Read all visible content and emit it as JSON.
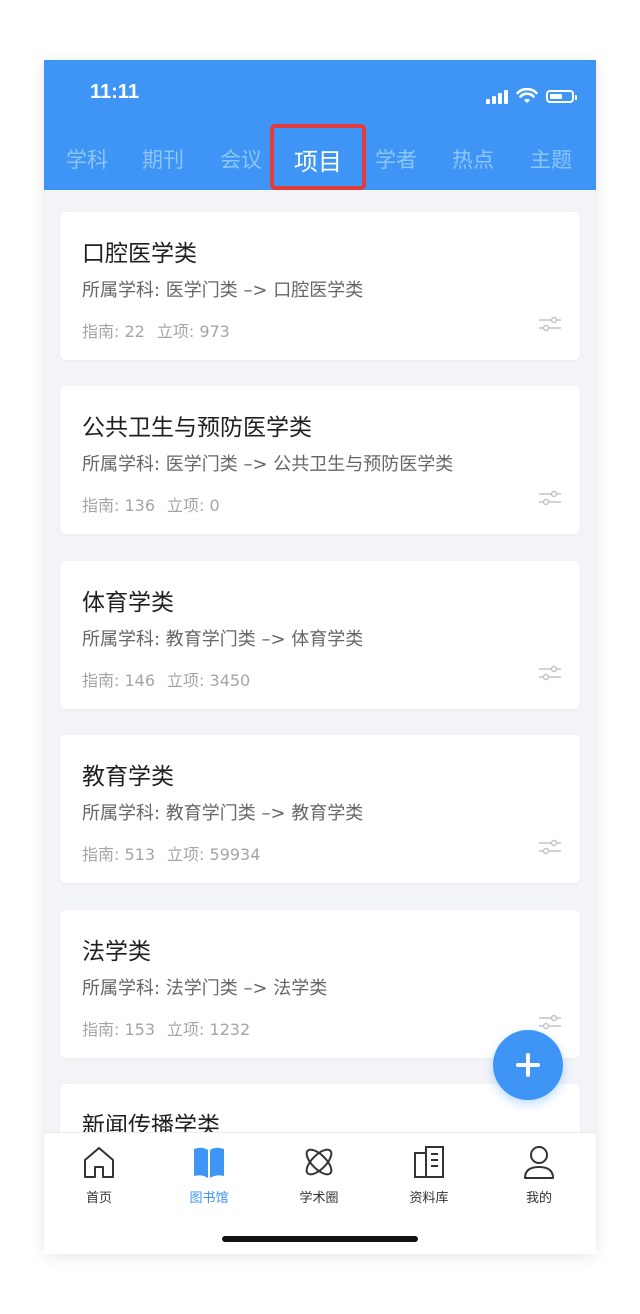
{
  "status_bar": {
    "time": "11:11"
  },
  "tabs": [
    {
      "label": "学科",
      "active": false
    },
    {
      "label": "期刊",
      "active": false
    },
    {
      "label": "会议",
      "active": false
    },
    {
      "label": "项目",
      "active": true
    },
    {
      "label": "学者",
      "active": false
    },
    {
      "label": "热点",
      "active": false
    },
    {
      "label": "主题",
      "active": false
    }
  ],
  "cards": [
    {
      "title": "口腔医学类",
      "subtitle": "所属学科: 医学门类 –> 口腔医学类",
      "guide": "指南: 22",
      "projects": "立项: 973"
    },
    {
      "title": "公共卫生与预防医学类",
      "subtitle": "所属学科: 医学门类 –> 公共卫生与预防医学类",
      "guide": "指南: 136",
      "projects": "立项: 0"
    },
    {
      "title": "体育学类",
      "subtitle": "所属学科: 教育学门类 –> 体育学类",
      "guide": "指南: 146",
      "projects": "立项: 3450"
    },
    {
      "title": "教育学类",
      "subtitle": "所属学科: 教育学门类 –> 教育学类",
      "guide": "指南: 513",
      "projects": "立项: 59934"
    },
    {
      "title": "法学类",
      "subtitle": "所属学科: 法学门类 –> 法学类",
      "guide": "指南: 153",
      "projects": "立项: 1232"
    },
    {
      "title": "新闻传播学类"
    }
  ],
  "tabbar": [
    {
      "label": "首页",
      "icon": "home-icon",
      "active": false
    },
    {
      "label": "图书馆",
      "icon": "book-icon",
      "active": true
    },
    {
      "label": "学术圈",
      "icon": "atom-icon",
      "active": false
    },
    {
      "label": "资料库",
      "icon": "building-icon",
      "active": false
    },
    {
      "label": "我的",
      "icon": "user-icon",
      "active": false
    }
  ],
  "colors": {
    "primary": "#3f95f5",
    "highlight": "#e53a3a",
    "inactive_tab": "#8cc6fb"
  }
}
